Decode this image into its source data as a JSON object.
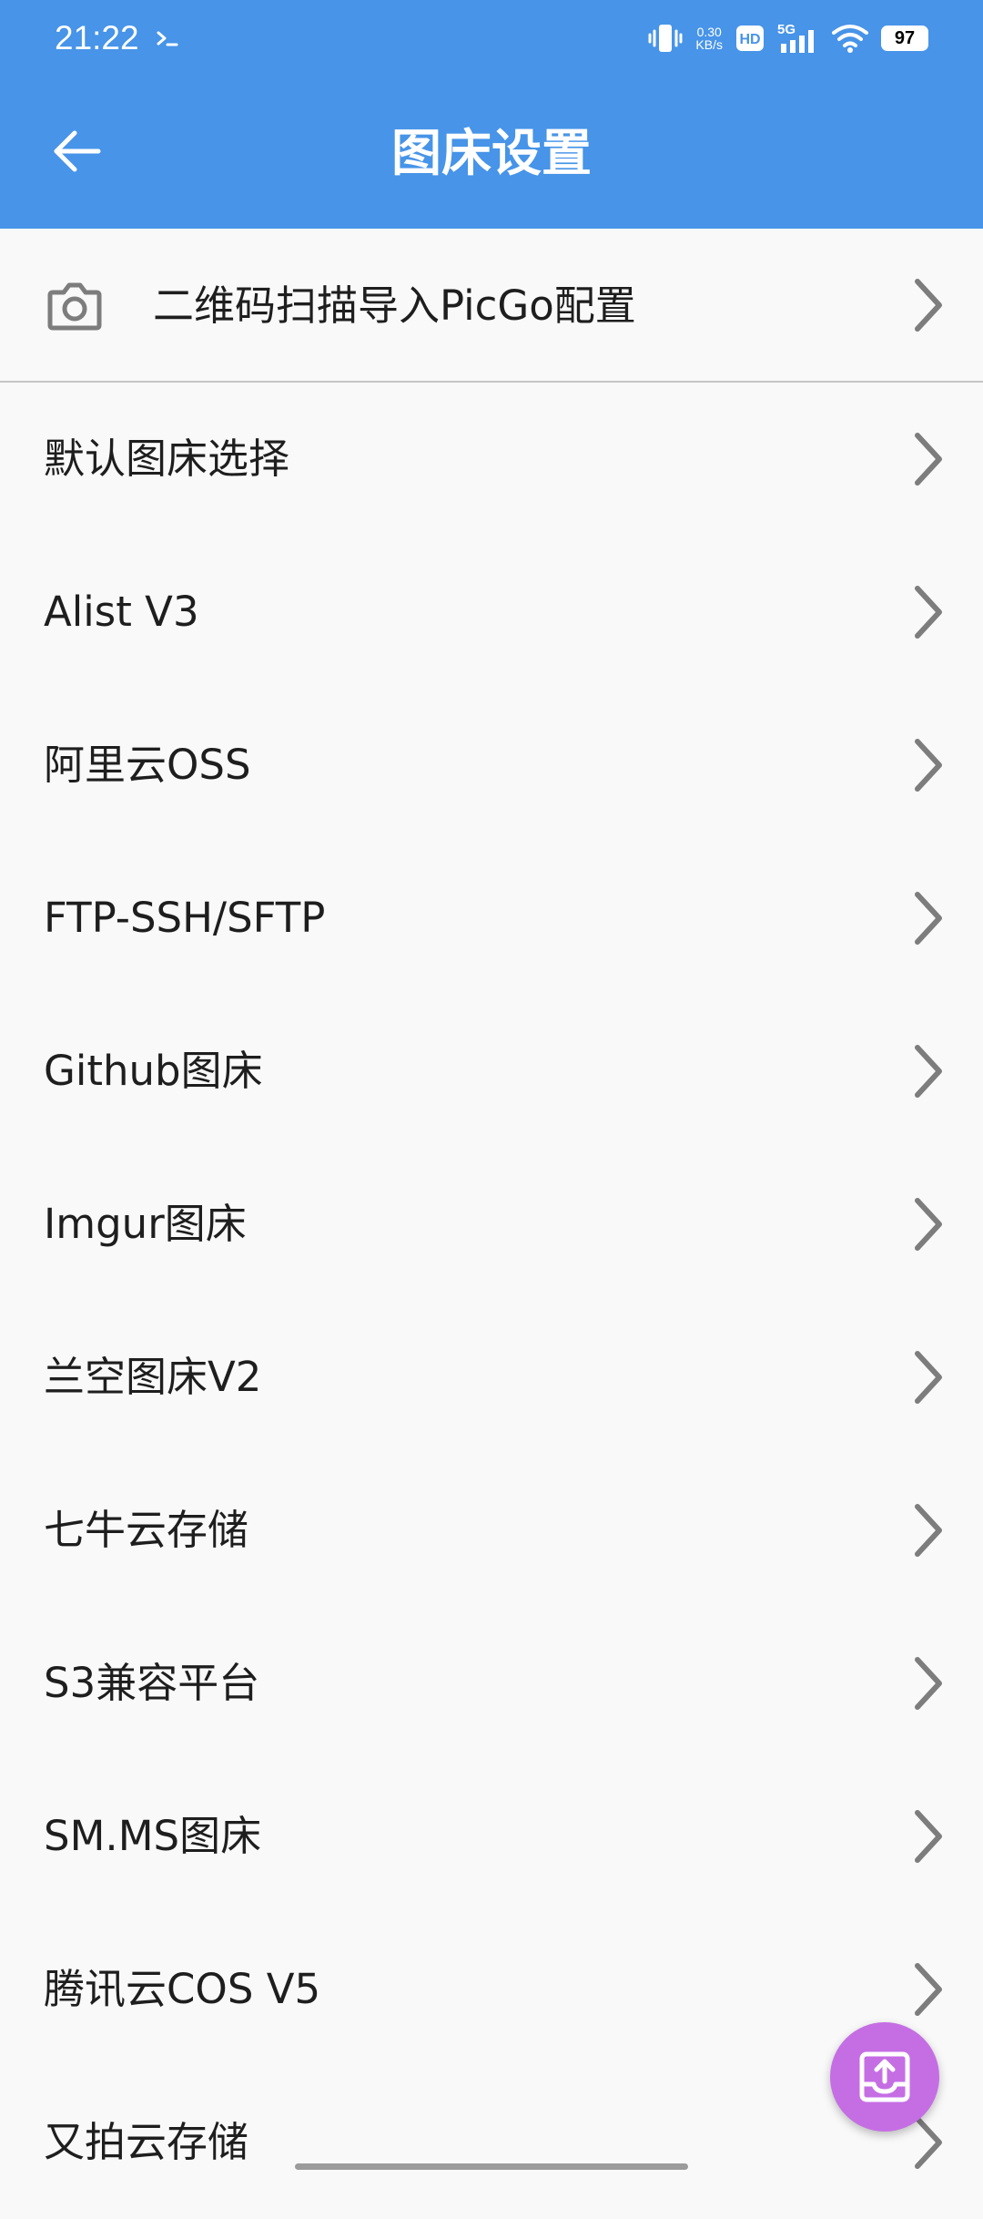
{
  "status_bar": {
    "time": "21:22",
    "net_speed_value": "0.30",
    "net_speed_unit": "KB/s",
    "hd_label": "HD",
    "network_label": "5G",
    "battery": "97"
  },
  "header": {
    "title": "图床设置"
  },
  "qr_import": {
    "label": "二维码扫描导入PicGo配置"
  },
  "settings_list": [
    {
      "label": "默认图床选择"
    },
    {
      "label": "Alist V3"
    },
    {
      "label": "阿里云OSS"
    },
    {
      "label": "FTP-SSH/SFTP"
    },
    {
      "label": "Github图床"
    },
    {
      "label": "Imgur图床"
    },
    {
      "label": "兰空图床V2"
    },
    {
      "label": "七牛云存储"
    },
    {
      "label": "S3兼容平台"
    },
    {
      "label": "SM.MS图床"
    },
    {
      "label": "腾讯云COS V5"
    },
    {
      "label": "又拍云存储"
    }
  ],
  "colors": {
    "header_bg": "#4794e8",
    "page_bg": "#f9f9f9",
    "fab_bg": "#c56ee4",
    "chevron": "#7d7d7d"
  },
  "icons": {
    "back": "arrow-left-icon",
    "qr": "camera-icon",
    "row_action": "chevron-right-icon",
    "fab": "upload-icon"
  }
}
